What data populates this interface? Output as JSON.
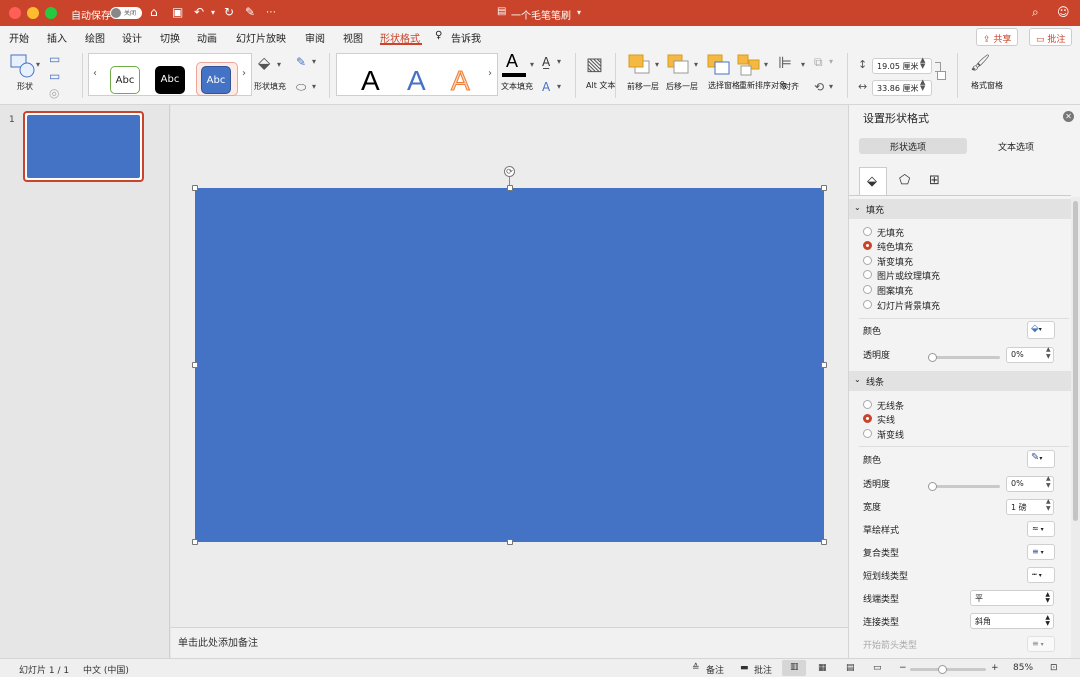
{
  "titlebar": {
    "autosave_label": "自动保存",
    "autosave_state": "关闭",
    "doc_title": "一个毛笔笔刷"
  },
  "tabs": [
    "开始",
    "插入",
    "绘图",
    "设计",
    "切换",
    "动画",
    "幻灯片放映",
    "审阅",
    "视图",
    "形状格式"
  ],
  "tell_me": "告诉我",
  "share_label": "共享",
  "comments_label": "批注",
  "ribbon": {
    "shapes": "形状",
    "style_samples": [
      "Abc",
      "Abc",
      "Abc"
    ],
    "shape_fill": "形状填充",
    "wordart_sample": "A",
    "text_fill": "文本填充",
    "alt_text": "Alt 文本",
    "bring_forward": "前移一层",
    "send_backward": "后移一层",
    "selection_pane": "选择窗格",
    "reorder_objects": "重新排序对象",
    "align": "对齐",
    "height_value": "19.05 厘米",
    "width_value": "33.86 厘米",
    "format_pane": "格式窗格"
  },
  "slides": {
    "number": "1"
  },
  "notes_placeholder": "单击此处添加备注",
  "panel": {
    "title": "设置形状格式",
    "tab_shape": "形状选项",
    "tab_text": "文本选项",
    "fill_section": "填充",
    "fill_options": [
      "无填充",
      "纯色填充",
      "渐变填充",
      "图片或纹理填充",
      "图案填充",
      "幻灯片背景填充"
    ],
    "fill_selected": 1,
    "color_label": "颜色",
    "transparency_label": "透明度",
    "fill_transparency": "0%",
    "line_section": "线条",
    "line_options": [
      "无线条",
      "实线",
      "渐变线"
    ],
    "line_selected": 1,
    "line_color_label": "颜色",
    "line_transparency_label": "透明度",
    "line_transparency": "0%",
    "width_label": "宽度",
    "width_value": "1 磅",
    "sketch_label": "草绘样式",
    "compound_label": "复合类型",
    "dash_label": "短划线类型",
    "cap_label": "线端类型",
    "cap_value": "平",
    "join_label": "连接类型",
    "join_value": "斜角",
    "arrow_begin_label": "开始箭头类型"
  },
  "statusbar": {
    "slide_info": "幻灯片 1 / 1",
    "language": "中文 (中国)",
    "notes": "备注",
    "comments": "批注",
    "zoom": "85%"
  },
  "colors": {
    "accent": "#c9442a",
    "shape_fill": "#4472c4"
  }
}
